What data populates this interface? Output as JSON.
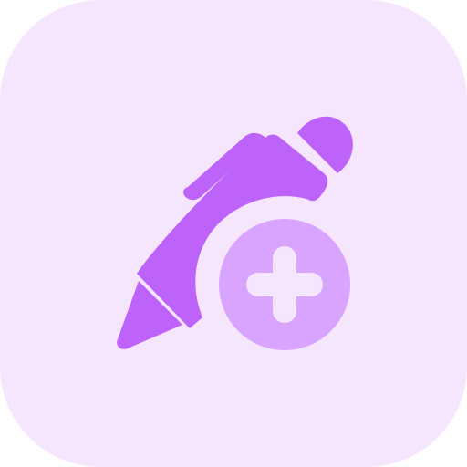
{
  "icon": {
    "name": "add-pen-icon",
    "colors": {
      "tile_background": "#f5e6fe",
      "pen": "#be63f9",
      "badge": "#d9a4fe",
      "plus": "#f5e6fe"
    }
  }
}
